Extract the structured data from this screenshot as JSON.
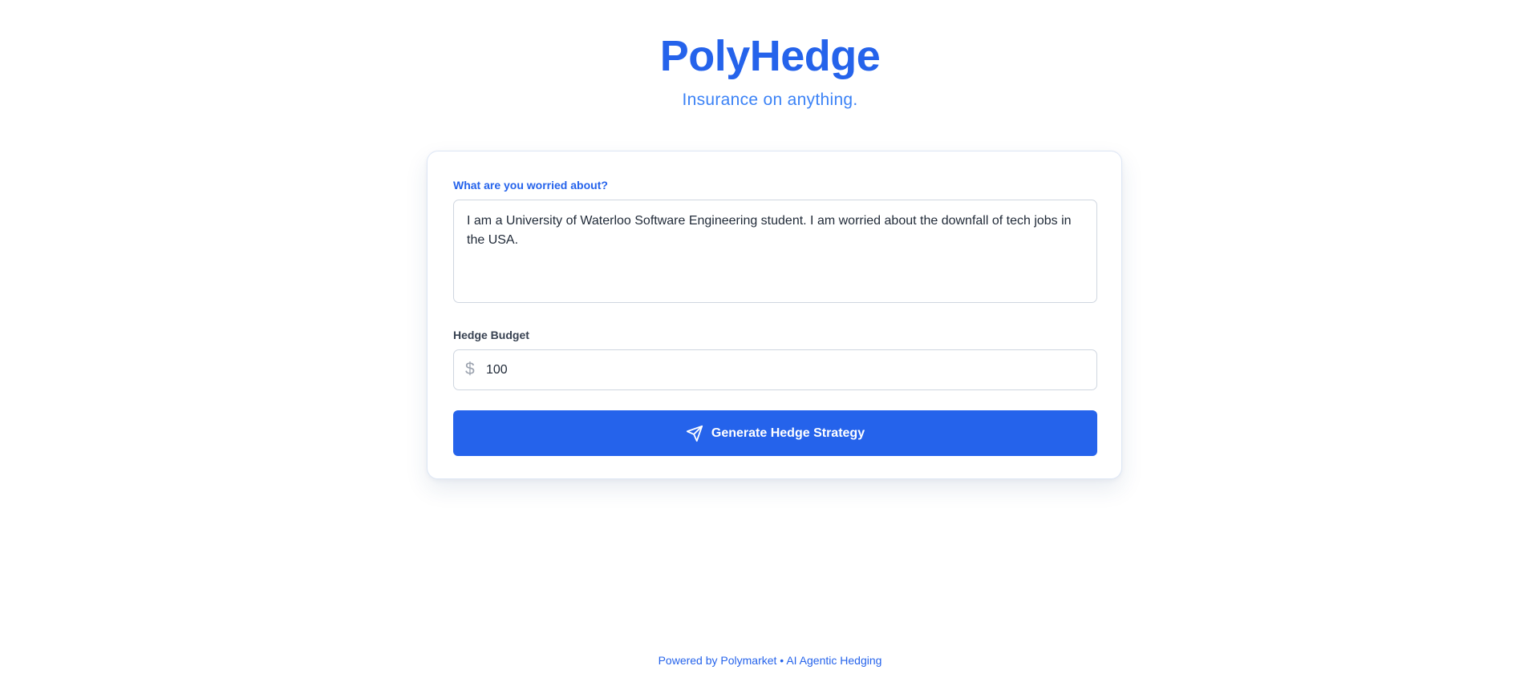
{
  "header": {
    "title": "PolyHedge",
    "tagline": "Insurance on anything."
  },
  "form": {
    "concern_label": "What are you worried about?",
    "concern_value": "I am a University of Waterloo Software Engineering student. I am worried about the downfall of tech jobs in the USA.",
    "budget_label": "Hedge Budget",
    "currency_symbol": "$",
    "budget_value": "100",
    "submit_label": "Generate Hedge Strategy",
    "submit_icon": "send-icon"
  },
  "footer": {
    "text": "Powered by Polymarket • AI Agentic Hedging"
  },
  "colors": {
    "accent": "#2563eb",
    "tagline": "#3b82f6",
    "border": "#cfd6e0"
  }
}
